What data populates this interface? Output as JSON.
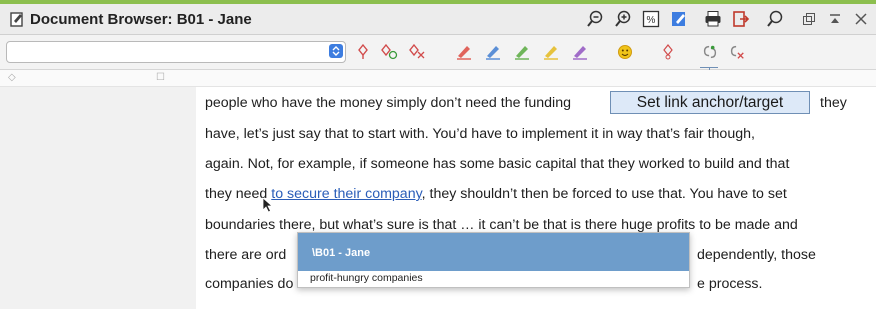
{
  "window": {
    "title": "Document Browser: B01 - Jane",
    "accent_color": "#8cbf4f"
  },
  "toolbar": {
    "combo_value": "",
    "icons": [
      "code-icon",
      "code-add-icon",
      "code-remove-icon",
      "pen-red-icon",
      "pen-blue-icon",
      "pen-green-icon",
      "pen-yellow-icon",
      "pen-purple-icon",
      "smiley-icon",
      "weight-icon",
      "link-anchor-icon",
      "link-remove-icon"
    ]
  },
  "tooltip": {
    "text": "Set link anchor/target"
  },
  "document": {
    "lines": [
      {
        "before": "people who have the money simply don’t need the funding",
        "link": "",
        "after": "",
        "tail": "they"
      },
      {
        "before": "have, let’s just say that to start with. You’d have to implement it in way that’s fair though,",
        "link": "",
        "after": ""
      },
      {
        "before": "again.  Not, for example, if someone has some basic capital that they worked to build and that",
        "link": "",
        "after": ""
      },
      {
        "before": "they need ",
        "link": "to secure their company",
        "after": ", they shouldn’t then be forced to use that. You have to set"
      },
      {
        "before": "boundaries there, but what’s sure is that … it can’t be that is there huge profits to be made and",
        "link": "",
        "after": ""
      },
      {
        "before": "there are ord",
        "link": "",
        "after": "",
        "tail": "dependently, those"
      },
      {
        "before": "companies do",
        "link": "",
        "after": "",
        "tail": "e process."
      }
    ]
  },
  "popup": {
    "header": "\\B01 - Jane",
    "item": "profit-hungry companies",
    "header_color": "#6e9dcb"
  }
}
